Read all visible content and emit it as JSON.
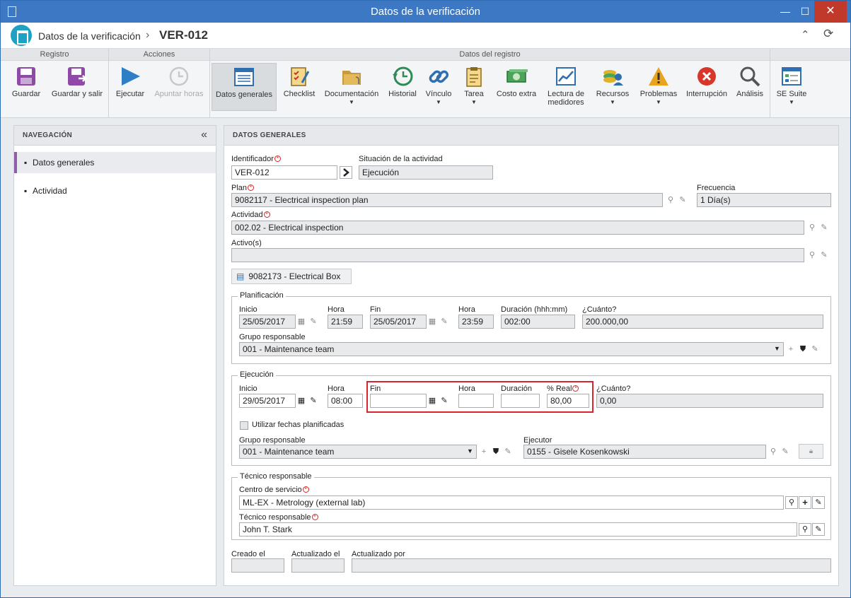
{
  "window": {
    "title": "Datos de la verificación",
    "minimize": "—",
    "maximize": "☐",
    "close": "✕"
  },
  "header": {
    "breadcrumb": "Datos de la verificación",
    "separator": "›",
    "record_id": "VER-012",
    "collapse_icon": "⌃",
    "refresh_icon": "⟳"
  },
  "ribbon": {
    "groups": {
      "registro": "Registro",
      "acciones": "Acciones",
      "datos": "Datos del registro"
    },
    "buttons": {
      "guardar": "Guardar",
      "guardar_salir": "Guardar y salir",
      "ejecutar": "Ejecutar",
      "apuntar": "Apuntar horas",
      "datos_generales": "Datos generales",
      "checklist": "Checklist",
      "documentacion": "Documentación",
      "historial": "Historial",
      "vinculo": "Vínculo",
      "tarea": "Tarea",
      "costo_extra": "Costo extra",
      "lectura1": "Lectura de",
      "lectura2": "medidores",
      "recursos": "Recursos",
      "problemas": "Problemas",
      "interrupcion": "Interrupción",
      "analisis": "Análisis",
      "se_suite": "SE Suite"
    }
  },
  "nav": {
    "title": "NAVEGACIÓN",
    "collapse": "«",
    "items": [
      "Datos generales",
      "Actividad"
    ]
  },
  "form": {
    "title": "DATOS GENERALES",
    "identificador_label": "Identificador",
    "identificador": "VER-012",
    "situacion_label": "Situación de la actividad",
    "situacion": "Ejecución",
    "plan_label": "Plan",
    "plan": "9082117 - Electrical inspection plan",
    "frecuencia_label": "Frecuencia",
    "frecuencia": "1 Día(s)",
    "actividad_label": "Actividad",
    "actividad": "002.02 - Electrical inspection",
    "activos_label": "Activo(s)",
    "activos": "",
    "asset_chip": "9082173 - Electrical Box",
    "planificacion": {
      "legend": "Planificación",
      "inicio_label": "Inicio",
      "inicio": "25/05/2017",
      "hora_label": "Hora",
      "hora": "21:59",
      "fin_label": "Fin",
      "fin": "25/05/2017",
      "hora_fin_label": "Hora",
      "hora_fin": "23:59",
      "duracion_label": "Duración (hhh:mm)",
      "duracion": "002:00",
      "cuanto_label": "¿Cuánto?",
      "cuanto": "200.000,00",
      "grupo_label": "Grupo responsable",
      "grupo": "001 - Maintenance team"
    },
    "ejecucion": {
      "legend": "Ejecución",
      "inicio_label": "Inicio",
      "inicio": "29/05/2017",
      "hora_label": "Hora",
      "hora": "08:00",
      "fin_label": "Fin",
      "fin": "",
      "hora_fin_label": "Hora",
      "hora_fin": "",
      "duracion_label": "Duración",
      "duracion": "",
      "real_label": "% Real",
      "real": "80,00",
      "cuanto_label": "¿Cuánto?",
      "cuanto": "0,00",
      "checkbox_label": "Utilizar fechas planificadas",
      "grupo_label": "Grupo responsable",
      "grupo": "001 - Maintenance team",
      "ejecutor_label": "Ejecutor",
      "ejecutor": "0155 - Gisele Kosenkowski"
    },
    "tecnico": {
      "legend": "Técnico responsable",
      "centro_label": "Centro de servicio",
      "centro": "ML-EX - Metrology (external lab)",
      "tecnico_label": "Técnico responsable",
      "tecnico": "John T. Stark"
    },
    "creado_label": "Creado el",
    "actualizado_label": "Actualizado el",
    "actualizado_por_label": "Actualizado por"
  }
}
